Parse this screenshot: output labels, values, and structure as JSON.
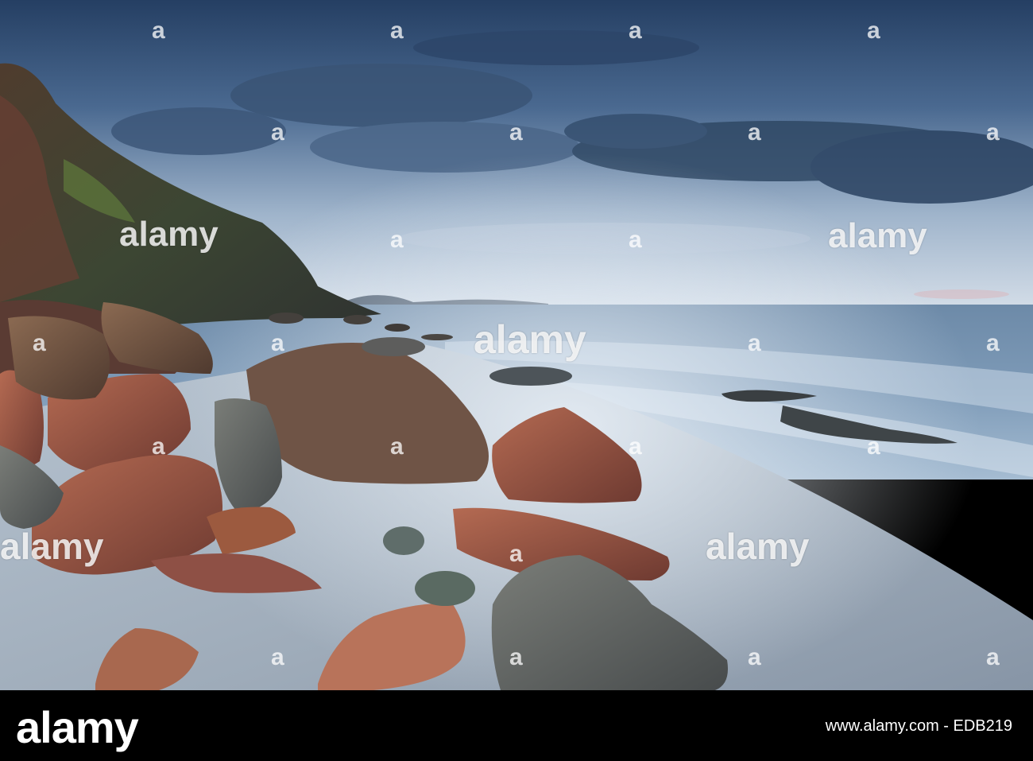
{
  "watermark": {
    "brand": "alamy",
    "tile_mark": "a"
  },
  "footer": {
    "logo": "alamy",
    "text": "www.alamy.com - EDB219"
  },
  "colors": {
    "sky_top": "#2c4a6e",
    "sky_mid": "#7b97b6",
    "sky_horizon": "#cfdae6",
    "sea": "#5e7f9e",
    "sand": "#a9b6c3",
    "rock_red": "#8a4b3c",
    "cliff": "#3c3a33"
  }
}
